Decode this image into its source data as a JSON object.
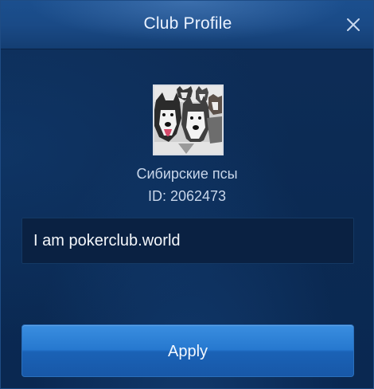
{
  "dialog": {
    "title": "Club Profile",
    "close_icon": "close-icon"
  },
  "club": {
    "avatar_icon": "club-avatar-huskies",
    "name": "Сибирские псы",
    "id_text": "ID: 2062473"
  },
  "description": {
    "value": "I am pokerclub.world"
  },
  "actions": {
    "apply_label": "Apply"
  },
  "colors": {
    "background": "#0c2a52",
    "header": "#1a4a86",
    "button": "#2678cf",
    "text": "#c8d6ea"
  }
}
